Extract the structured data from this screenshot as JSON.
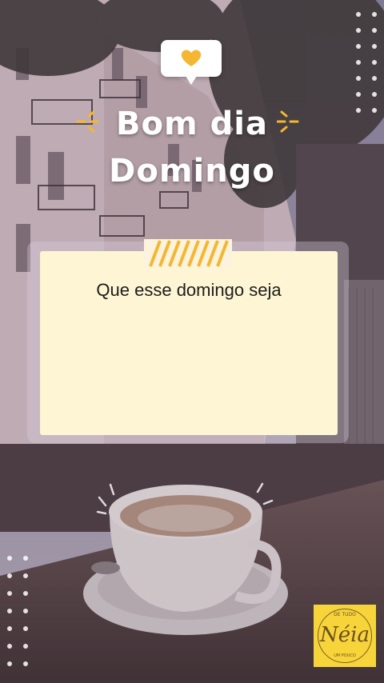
{
  "title": {
    "line1": "Bom dia",
    "line2": "Domingo"
  },
  "card": {
    "message": "Que esse domingo seja"
  },
  "icons": {
    "bubble": "heart-icon",
    "sparkles": "sparkle-icon",
    "tape": "washi-tape-icon",
    "dots": "dot-grid-icon"
  },
  "logo": {
    "top_text": "DE TUDO",
    "name": "Néia",
    "bottom_text": "UM POUCO"
  },
  "colors": {
    "accent": "#f5b731",
    "note": "#fdf5d4",
    "logo_bg": "#f7d43a"
  }
}
